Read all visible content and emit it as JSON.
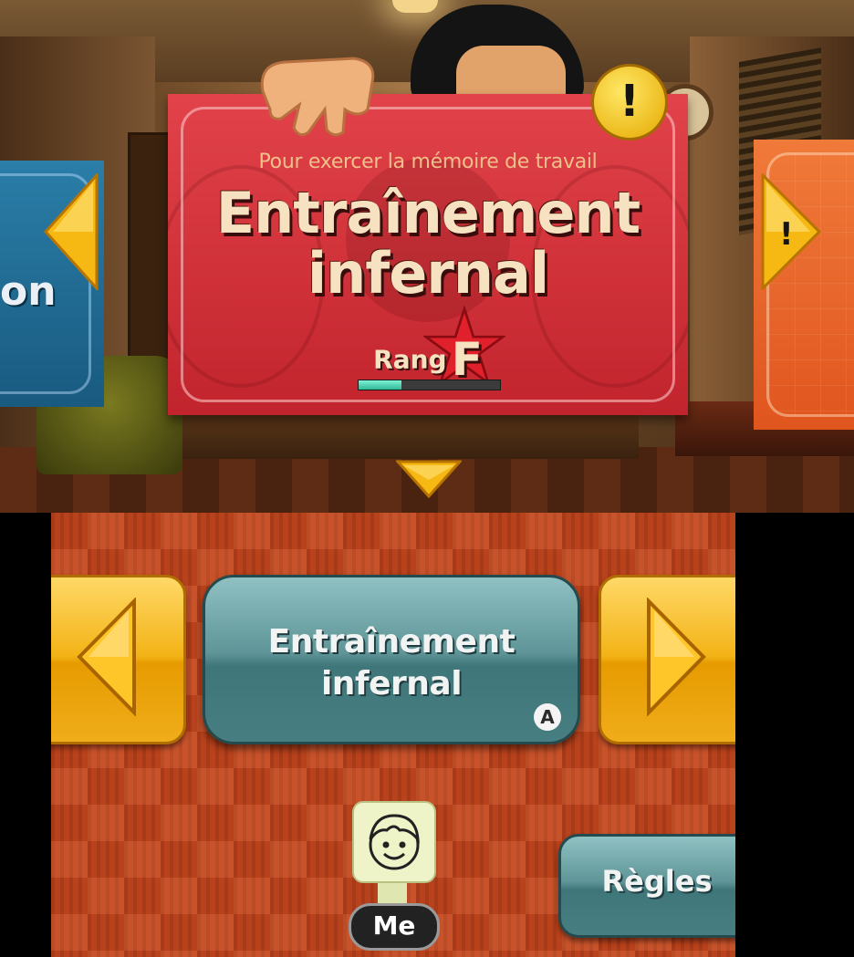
{
  "top_card": {
    "subtitle": "Pour exercer la mémoire de travail",
    "title_line1": "Entraînement",
    "title_line2": "infernal",
    "rank_label": "Rang",
    "rank_value": "F",
    "progress": 0.3,
    "alert_icon": "!"
  },
  "left_card": {
    "partial_text": "on"
  },
  "right_card": {
    "alert_icon": "!"
  },
  "bottom": {
    "main_button_line1": "Entraînement",
    "main_button_line2": "infernal",
    "a_badge": "A",
    "rules_label": "Règles",
    "profile_label": "Me"
  },
  "colors": {
    "card_red": "#d63038",
    "card_blue": "#1f6d96",
    "card_orange": "#ea6a2c",
    "gold": "#f3b316",
    "teal": "#5f9598"
  }
}
